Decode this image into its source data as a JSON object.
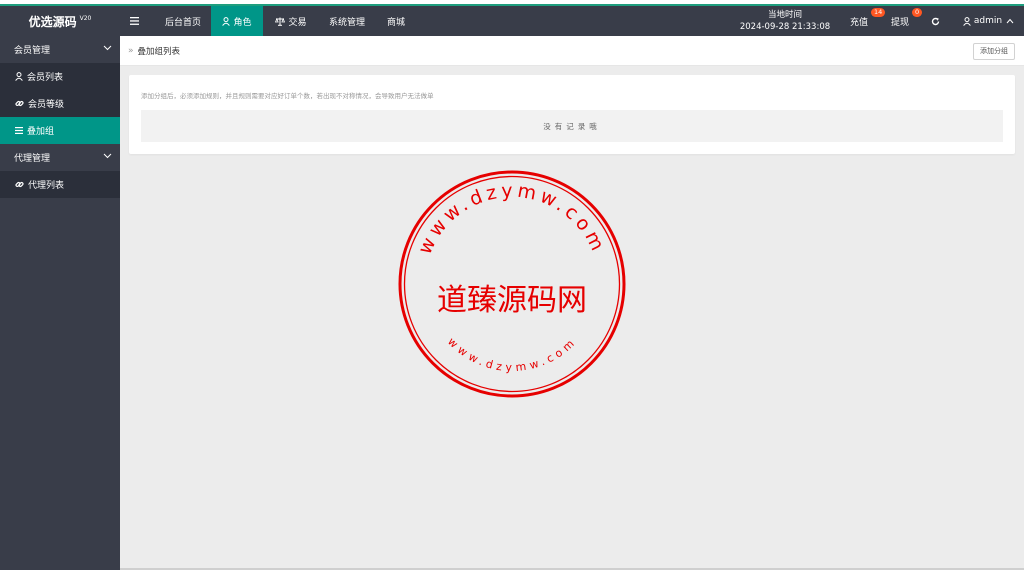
{
  "app": {
    "title": "优选源码",
    "version": "V20"
  },
  "header": {
    "menu_icon": "menu-icon",
    "nav": [
      "后台首页",
      "角色",
      "交易",
      "系统管理",
      "商城"
    ],
    "time_label": "当地时间",
    "time_value": "2024-09-28 21:33:08",
    "recharge_label": "充值",
    "recharge_badge": "14",
    "withdraw_label": "提现",
    "withdraw_badge": "0",
    "user": "admin"
  },
  "sidebar": {
    "groups": [
      {
        "label": "会员管理",
        "items": [
          "会员列表",
          "会员等级",
          "叠加组"
        ]
      },
      {
        "label": "代理管理",
        "items": [
          "代理列表"
        ]
      }
    ]
  },
  "breadcrumb": {
    "current": "叠加组列表"
  },
  "toolbar": {
    "add_label": "添加分组"
  },
  "card": {
    "hint": "添加分组后，必须添加规则，并且规则需要对应好订单个数，若出现不对称情况，会导致用户无法做单",
    "empty": "没有记录哦"
  },
  "stamp": {
    "center_text": "道臻源码网",
    "ring_text": "www.dzymw.com"
  },
  "colors": {
    "accent": "#009688",
    "header_bg": "#393d49",
    "badge": "#ff5722",
    "stamp": "#e60000"
  }
}
